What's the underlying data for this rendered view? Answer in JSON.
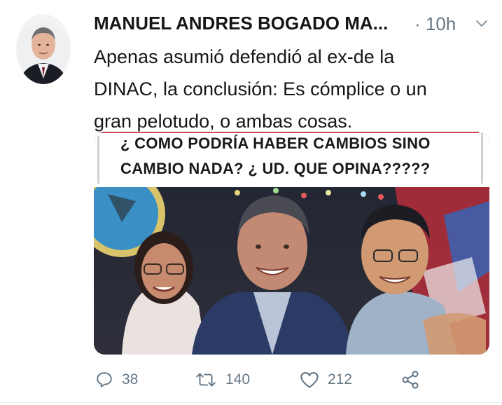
{
  "tweet": {
    "author_name": "MANUEL ANDRES BOGADO MA...",
    "time": "· 10h",
    "text_lines": [
      "Apenas asumió defendió al ex-de la",
      "DINAC, la conclusión: Es cómplice o un",
      "gran pelotudo, o ambas cosas."
    ]
  },
  "media": {
    "banner_lines": [
      "¿ COMO PODRÍA HABER CAMBIOS SINO",
      "CAMBIO NADA? ¿ UD. QUE OPINA?????"
    ]
  },
  "actions": {
    "reply_count": "38",
    "retweet_count": "140",
    "like_count": "212"
  },
  "icons": {
    "reply": "reply-icon",
    "retweet": "retweet-icon",
    "like": "heart-icon",
    "share": "share-icon",
    "menu": "chevron-down-icon"
  },
  "colors": {
    "text": "#14171a",
    "secondary": "#657786",
    "divider": "#e6ecf0"
  }
}
